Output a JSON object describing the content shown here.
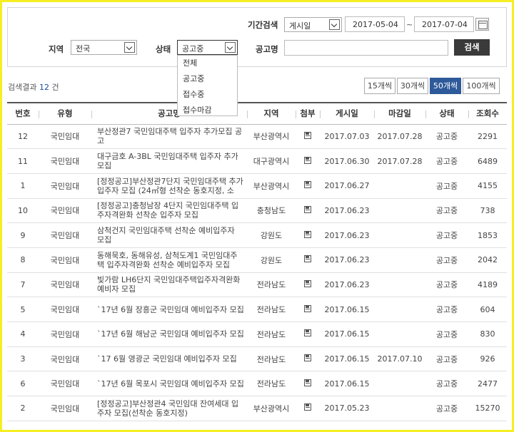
{
  "search": {
    "period_label": "기간검색",
    "period_type": "게시일",
    "start_date": "2017-05-04",
    "date_sep": "~",
    "end_date": "2017-07-04",
    "region_label": "지역",
    "region_value": "전국",
    "status_label": "상태",
    "status_value": "공고중",
    "notice_label": "공고명",
    "notice_value": "",
    "search_button": "검색",
    "status_options": [
      "전체",
      "공고중",
      "접수중",
      "접수마감"
    ]
  },
  "results": {
    "prefix": "검색결과",
    "count": "12",
    "suffix": "건"
  },
  "page_sizes": [
    {
      "label": "15개씩",
      "active": false
    },
    {
      "label": "30개씩",
      "active": false
    },
    {
      "label": "50개씩",
      "active": true
    },
    {
      "label": "100개씩",
      "active": false
    }
  ],
  "table": {
    "headers": [
      "번호",
      "유형",
      "공고명",
      "지역",
      "첨부",
      "게시일",
      "마감일",
      "상태",
      "조회수"
    ],
    "rows": [
      {
        "no": "12",
        "type": "국민임대",
        "title": "부산정관7 국민임대주택 입주자 추가모집 공고",
        "region": "부산광역시",
        "posted": "2017.07.03",
        "deadline": "2017.07.28",
        "status": "공고중",
        "views": "2291"
      },
      {
        "no": "11",
        "type": "국민임대",
        "title": "대구금호 A-3BL 국민임대주택 입주자 추가모집",
        "region": "대구광역시",
        "posted": "2017.06.30",
        "deadline": "2017.07.28",
        "status": "공고중",
        "views": "6489"
      },
      {
        "no": "1",
        "type": "국민임대",
        "title": "[정정공고]부산정관7단지 국민임대주택 추가 입주자 모집 (24㎡형 선착순 동호지정, 소",
        "region": "부산광역시",
        "posted": "2017.06.27",
        "deadline": "",
        "status": "공고중",
        "views": "4155"
      },
      {
        "no": "10",
        "type": "국민임대",
        "title": "[정정공고]충청남장 4단지 국민임대주택 입주자격완화 선착순 입주자 모집",
        "region": "충청남도",
        "posted": "2017.06.23",
        "deadline": "",
        "status": "공고중",
        "views": "738"
      },
      {
        "no": "9",
        "type": "국민임대",
        "title": "삼척건지 국민임대주택 선착순 예비입주자 모집",
        "region": "강원도",
        "posted": "2017.06.23",
        "deadline": "",
        "status": "공고중",
        "views": "1853"
      },
      {
        "no": "8",
        "type": "국민임대",
        "title": "동해묵호, 동해유성, 삼척도계1 국민임대주택 입주자격완화 선착순 예비입주자 모집",
        "region": "강원도",
        "posted": "2017.06.23",
        "deadline": "",
        "status": "공고중",
        "views": "2042"
      },
      {
        "no": "7",
        "type": "국민임대",
        "title": "빛가람 LH6단지 국민임대주택입주자격완화 예비자 모집",
        "region": "전라남도",
        "posted": "2017.06.23",
        "deadline": "",
        "status": "공고중",
        "views": "4189"
      },
      {
        "no": "5",
        "type": "국민임대",
        "title": "`17년 6월 장흥군 국민임대 예비입주자 모집",
        "region": "전라남도",
        "posted": "2017.06.15",
        "deadline": "",
        "status": "공고중",
        "views": "604"
      },
      {
        "no": "4",
        "type": "국민임대",
        "title": "`17년 6월 해남군 국민임대 예비입주자 모집",
        "region": "전라남도",
        "posted": "2017.06.15",
        "deadline": "",
        "status": "공고중",
        "views": "830"
      },
      {
        "no": "3",
        "type": "국민임대",
        "title": "`17 6월 영광군 국민임대 예비입주자 모집",
        "region": "전라남도",
        "posted": "2017.06.15",
        "deadline": "2017.07.10",
        "status": "공고중",
        "views": "926"
      },
      {
        "no": "6",
        "type": "국민임대",
        "title": "`17년 6월 목포시 국민임대 예비입주자 모집",
        "region": "전라남도",
        "posted": "2017.06.15",
        "deadline": "",
        "status": "공고중",
        "views": "2477"
      },
      {
        "no": "2",
        "type": "국민임대",
        "title": "[정정공고]부산정관4 국민임대 잔여세대 입주자 모집(선착순 동호지정)",
        "region": "부산광역시",
        "posted": "2017.05.23",
        "deadline": "",
        "status": "공고중",
        "views": "15270"
      }
    ]
  }
}
